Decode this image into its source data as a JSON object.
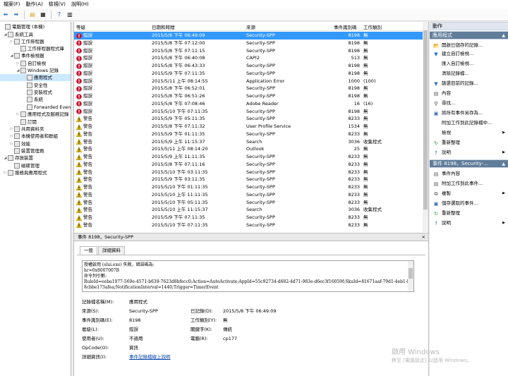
{
  "menu": {
    "items": [
      "檔案(F)",
      "動作(A)",
      "檢視(V)",
      "說明(H)"
    ]
  },
  "tree": [
    {
      "label": "電腦管理 (本機)",
      "expander": "",
      "level": 0,
      "selected": false
    },
    {
      "label": "系統工具",
      "expander": "◢",
      "level": 1,
      "selected": false
    },
    {
      "label": "工作排程器",
      "expander": "▷",
      "level": 2,
      "selected": false
    },
    {
      "label": "工作排程器程式庫",
      "expander": "",
      "level": 3,
      "selected": false
    },
    {
      "label": "事件檢視器",
      "expander": "◢",
      "level": 2,
      "selected": false
    },
    {
      "label": "自訂檢視",
      "expander": "▷",
      "level": 3,
      "selected": false
    },
    {
      "label": "Windows 記錄",
      "expander": "◢",
      "level": 3,
      "selected": false
    },
    {
      "label": "應用程式",
      "expander": "",
      "level": 4,
      "selected": true
    },
    {
      "label": "安全性",
      "expander": "",
      "level": 4,
      "selected": false
    },
    {
      "label": "安裝程式",
      "expander": "",
      "level": 4,
      "selected": false
    },
    {
      "label": "系統",
      "expander": "",
      "level": 4,
      "selected": false
    },
    {
      "label": "Forwarded Events",
      "expander": "",
      "level": 4,
      "selected": false
    },
    {
      "label": "應用程式及服務記錄",
      "expander": "▷",
      "level": 3,
      "selected": false
    },
    {
      "label": "訂閱",
      "expander": "",
      "level": 3,
      "selected": false
    },
    {
      "label": "共用資料夾",
      "expander": "▷",
      "level": 2,
      "selected": false
    },
    {
      "label": "本機使用者和群組",
      "expander": "▷",
      "level": 2,
      "selected": false
    },
    {
      "label": "效能",
      "expander": "▷",
      "level": 2,
      "selected": false
    },
    {
      "label": "裝置管理員",
      "expander": "",
      "level": 2,
      "selected": false
    },
    {
      "label": "存放裝置",
      "expander": "◢",
      "level": 1,
      "selected": false
    },
    {
      "label": "磁碟管理",
      "expander": "",
      "level": 2,
      "selected": false
    },
    {
      "label": "服務與應用程式",
      "expander": "▷",
      "level": 1,
      "selected": false
    }
  ],
  "grid": {
    "headers": [
      "等級",
      "日期和時間",
      "來源",
      "事件識別碼",
      "工作類別"
    ],
    "rows": [
      [
        "錯誤",
        "2015/5/8 下午 06:49:09",
        "Security-SPP",
        "8198",
        "無"
      ],
      [
        "錯誤",
        "2015/5/8 下午 07:12:00",
        "Security-SPP",
        "8198",
        "無"
      ],
      [
        "錯誤",
        "2015/5/8 下午 07:11:15",
        "Security-SPP",
        "8198",
        "無"
      ],
      [
        "錯誤",
        "2015/5/8 下午 06:40:08",
        "CAPI2",
        "513",
        "無"
      ],
      [
        "錯誤",
        "2015/5/8 下午 06:43:33",
        "Security-SPP",
        "8198",
        "無"
      ],
      [
        "錯誤",
        "2015/5/9 下午 07:11:35",
        "Security-SPP",
        "8198",
        "無"
      ],
      [
        "錯誤",
        "2015/5/11 上午 08:14:55",
        "Application Error",
        "1000",
        "(100)"
      ],
      [
        "錯誤",
        "2015/5/8 下午 06:52:01",
        "Security-SPP",
        "8198",
        "無"
      ],
      [
        "錯誤",
        "2015/5/8 下午 06:51:26",
        "Security-SPP",
        "8198",
        "無"
      ],
      [
        "錯誤",
        "2015/5/8 下午 07:08:46",
        "Adobe Reader",
        "16",
        "(16)"
      ],
      [
        "錯誤",
        "2015/5/10 下午 07:11:35",
        "Security-SPP",
        "8198",
        "無"
      ],
      [
        "警告",
        "2015/5/9 下午 05:11:35",
        "Security-SPP",
        "8233",
        "無"
      ],
      [
        "警告",
        "2015/5/8 下午 07:11:32",
        "User Profile Service",
        "1534",
        "無"
      ],
      [
        "警告",
        "2015/5/9 下午 01:11:35",
        "Security-SPP",
        "8233",
        "無"
      ],
      [
        "警告",
        "2015/5/9 上午 11:15:37",
        "Search",
        "3036",
        "收集程式"
      ],
      [
        "警告",
        "2015/5/11 上午 08:14:20",
        "Outlook",
        "25",
        "無"
      ],
      [
        "警告",
        "2015/5/9 上午 11:11:35",
        "Security-SPP",
        "8233",
        "無"
      ],
      [
        "警告",
        "2015/5/8 下午 07:11:16",
        "Security-SPP",
        "8233",
        "無"
      ],
      [
        "警告",
        "2015/5/10 下午 03:11:35",
        "Security-SPP",
        "8233",
        "無"
      ],
      [
        "警告",
        "2015/5/9 下午 03:11:35",
        "Security-SPP",
        "8233",
        "無"
      ],
      [
        "警告",
        "2015/5/10 下午 01:11:35",
        "Security-SPP",
        "8233",
        "無"
      ],
      [
        "警告",
        "2015/5/10 上午 11:11:35",
        "Security-SPP",
        "8233",
        "無"
      ],
      [
        "警告",
        "2015/5/10 下午 05:11:35",
        "Security-SPP",
        "8233",
        "無"
      ],
      [
        "警告",
        "2015/5/10 上午 11:15:37",
        "Search",
        "3036",
        "收集程式"
      ],
      [
        "警告",
        "2015/5/9 下午 07:11:35",
        "Security-SPP",
        "8233",
        "無"
      ],
      [
        "警告",
        "2015/5/10 下午 07:11:35",
        "Security-SPP",
        "8233",
        "無"
      ]
    ]
  },
  "detail": {
    "title": "事件 8198，Security-SPP",
    "close": "×",
    "tabs": [
      "一般",
      "詳細資料"
    ],
    "message": [
      "授權啟用 (slui.exe) 失敗，錯誤碼為:",
      "hr=0x8007007B",
      "命令列引數:",
      "RuleId=eeba1977-569e-4571-b639-7623d8bfecc0;Action=AutoActivate;AppId=55c92734-d682-4d71-983e-d6ec3f16059f;SkuId=81671aaf-79d1-4eb1-b004-",
      "8cbbe173afea;NotificationInterval=1440;Trigger=TimerEvent"
    ],
    "fields": {
      "log_name_label": "記錄檔名稱(M):",
      "log_name": "應用程式",
      "source_label": "來源(S):",
      "source": "Security-SPP",
      "logged_label": "已記錄(D):",
      "logged": "2015/5/8 下午 06:49:09",
      "event_id_label": "事件識別碼(E):",
      "event_id": "8198",
      "task_label": "工作類別(Y):",
      "task": "無",
      "level_label": "層級(L):",
      "level": "錯誤",
      "keywords_label": "關鍵字(K):",
      "keywords": "傳統",
      "user_label": "使用者(U):",
      "user": "不適用",
      "computer_label": "電腦(R):",
      "computer": "cp177",
      "opcode_label": "OpCode(O):",
      "opcode": "資訊",
      "more_label": "詳細資訊(I):",
      "more_link": "事件記錄檔線上說明"
    }
  },
  "actions": {
    "title": "動作",
    "section1": "應用程式",
    "items1": [
      {
        "label": "開啟已儲存的記錄...",
        "icon": "folder-icon",
        "sub": false
      },
      {
        "label": "建立自訂檢視...",
        "icon": "filter-add-icon",
        "sub": false
      },
      {
        "label": "匯入自訂檢視...",
        "icon": "",
        "sub": false
      },
      {
        "label": "清除記錄檔...",
        "icon": "",
        "sub": false
      },
      {
        "label": "篩選目前的記錄...",
        "icon": "filter-icon",
        "sub": false
      },
      {
        "label": "內容",
        "icon": "properties-icon",
        "sub": false
      },
      {
        "label": "尋找...",
        "icon": "find-icon",
        "sub": false
      },
      {
        "label": "將所有事件另存為...",
        "icon": "save-icon",
        "sub": false
      },
      {
        "label": "附加工作到此記錄檔中...",
        "icon": "",
        "sub": false
      },
      {
        "label": "檢視",
        "icon": "",
        "sub": true
      },
      {
        "label": "重新整理",
        "icon": "refresh-icon",
        "sub": false
      },
      {
        "label": "說明",
        "icon": "help-icon",
        "sub": true
      }
    ],
    "section2": "事件 8198，Security-...",
    "items2": [
      {
        "label": "事件內容",
        "icon": "event-props-icon",
        "sub": false
      },
      {
        "label": "附加工作到此事件...",
        "icon": "task-icon",
        "sub": false
      },
      {
        "label": "複製",
        "icon": "copy-icon",
        "sub": true
      },
      {
        "label": "儲存選取的事件...",
        "icon": "save-icon",
        "sub": false
      },
      {
        "label": "重新整理",
        "icon": "refresh-icon",
        "sub": false
      },
      {
        "label": "說明",
        "icon": "help-icon",
        "sub": true
      }
    ]
  },
  "watermark": {
    "line1": "啟用 Windows",
    "line2": "移至 [電腦設定] 以啟用 Windows。"
  },
  "colors": {
    "selection": "#3399ff",
    "error": "#c8102e",
    "warning": "#f2c811",
    "actions_header": "#607d9a"
  }
}
